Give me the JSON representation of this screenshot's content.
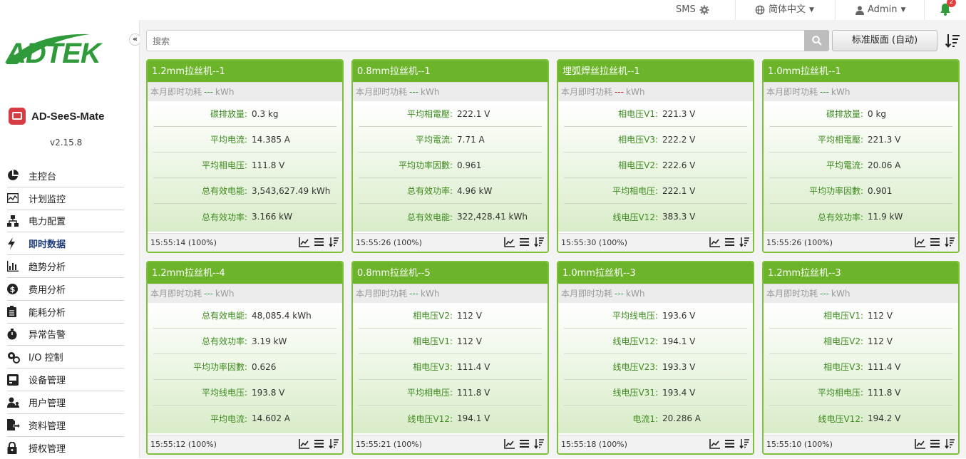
{
  "topbar": {
    "sms": "SMS",
    "language": "简体中文",
    "user": "Admin",
    "notifications": "2"
  },
  "sidebar": {
    "logo": "ADTEK",
    "app_name": "AD-SeeS-Mate",
    "version": "v2.15.8",
    "menu": [
      {
        "label": "主控台",
        "icon": "pie-chart-icon"
      },
      {
        "label": "计划监控",
        "icon": "monitor-icon"
      },
      {
        "label": "电力配置",
        "icon": "sitemap-icon"
      },
      {
        "label": "即时数据",
        "icon": "bolt-icon",
        "active": true
      },
      {
        "label": "趋势分析",
        "icon": "bar-chart-icon"
      },
      {
        "label": "费用分析",
        "icon": "dollar-icon"
      },
      {
        "label": "能耗分析",
        "icon": "clipboard-icon"
      },
      {
        "label": "异常告警",
        "icon": "alarm-icon"
      },
      {
        "label": "I/O 控制",
        "icon": "gears-icon"
      },
      {
        "label": "设备管理",
        "icon": "device-icon"
      },
      {
        "label": "用户管理",
        "icon": "users-icon"
      },
      {
        "label": "资料管理",
        "icon": "export-icon"
      },
      {
        "label": "授权管理",
        "icon": "lock-icon"
      }
    ]
  },
  "toolbar": {
    "search_placeholder": "搜索",
    "layout_button": "标准版面 (自动)"
  },
  "colors": {
    "brand_green": "#6cb52b",
    "label_green": "#3d8a1e",
    "active_menu": "#1c3a7a"
  },
  "cards": [
    {
      "title": "1.2mm拉丝机--1",
      "sub_label": "本月即时功耗",
      "sub_dash": "---",
      "sub_unit": "kWh",
      "rows": [
        {
          "label": "碳排放量:",
          "value": "0.3 kg"
        },
        {
          "label": "平均电流:",
          "value": "14.385 A"
        },
        {
          "label": "平均相电压:",
          "value": "111.8 V"
        },
        {
          "label": "总有效电能:",
          "value": "3,543,627.49 kWh"
        },
        {
          "label": "总有效功率:",
          "value": "3.166 kW"
        }
      ],
      "footer": "15:55:14 (100%)"
    },
    {
      "title": "0.8mm拉丝机--1",
      "sub_label": "本月即时功耗",
      "sub_dash": "---",
      "sub_unit": "kWh",
      "rows": [
        {
          "label": "平均相電壓:",
          "value": "222.1 V"
        },
        {
          "label": "平均電流:",
          "value": "7.71 A"
        },
        {
          "label": "平均功率因數:",
          "value": "0.961"
        },
        {
          "label": "总有效功率:",
          "value": "4.96 kW"
        },
        {
          "label": "总有效电能:",
          "value": "322,428.41 kWh"
        }
      ],
      "footer": "15:55:26 (100%)"
    },
    {
      "title": "埋弧焊丝拉丝机--1",
      "sub_label": "本月即时功耗",
      "sub_dash": "---",
      "sub_unit": "kWh",
      "dash_red": true,
      "rows": [
        {
          "label": "相电压V1:",
          "value": "221.3 V"
        },
        {
          "label": "相电压V3:",
          "value": "222.2 V"
        },
        {
          "label": "相电压V2:",
          "value": "222.6 V"
        },
        {
          "label": "平均相电压:",
          "value": "222.1 V"
        },
        {
          "label": "线电压V12:",
          "value": "383.3 V"
        }
      ],
      "footer": "15:55:30 (100%)"
    },
    {
      "title": "1.0mm拉丝机--1",
      "sub_label": "本月即时功耗",
      "sub_dash": "---",
      "sub_unit": "kWh",
      "rows": [
        {
          "label": "碳排放量:",
          "value": "0 kg"
        },
        {
          "label": "平均相電壓:",
          "value": "221.3 V"
        },
        {
          "label": "平均電流:",
          "value": "20.06 A"
        },
        {
          "label": "平均功率因數:",
          "value": "0.901"
        },
        {
          "label": "总有效功率:",
          "value": "11.9 kW"
        }
      ],
      "footer": "15:55:26 (100%)"
    },
    {
      "title": "1.2mm拉丝机--4",
      "sub_label": "本月即时功耗",
      "sub_dash": "---",
      "sub_unit": "kWh",
      "rows": [
        {
          "label": "总有效电能:",
          "value": "48,085.4 kWh"
        },
        {
          "label": "总有效功率:",
          "value": "3.19 kW"
        },
        {
          "label": "平均功率因數:",
          "value": "0.626"
        },
        {
          "label": "平均线电压:",
          "value": "193.8 V"
        },
        {
          "label": "平均电流:",
          "value": "14.602 A"
        }
      ],
      "footer": "15:55:12 (100%)"
    },
    {
      "title": "0.8mm拉丝机--5",
      "sub_label": "本月即时功耗",
      "sub_dash": "---",
      "sub_unit": "kWh",
      "rows": [
        {
          "label": "相电压V2:",
          "value": "112 V"
        },
        {
          "label": "相电压V1:",
          "value": "112 V"
        },
        {
          "label": "相电压V3:",
          "value": "111.4 V"
        },
        {
          "label": "平均相电压:",
          "value": "111.8 V"
        },
        {
          "label": "线电压V12:",
          "value": "194.1 V"
        }
      ],
      "footer": "15:55:21 (100%)"
    },
    {
      "title": "1.0mm拉丝机--3",
      "sub_label": "本月即时功耗",
      "sub_dash": "---",
      "sub_unit": "kWh",
      "rows": [
        {
          "label": "平均线电压:",
          "value": "193.6 V"
        },
        {
          "label": "线电压V12:",
          "value": "194.1 V"
        },
        {
          "label": "线电压V23:",
          "value": "193.3 V"
        },
        {
          "label": "线电压V31:",
          "value": "193.4 V"
        },
        {
          "label": "电流1:",
          "value": "20.286 A"
        }
      ],
      "footer": "15:55:18 (100%)"
    },
    {
      "title": "1.2mm拉丝机--3",
      "sub_label": "本月即时功耗",
      "sub_dash": "---",
      "sub_unit": "kWh",
      "rows": [
        {
          "label": "相电压V1:",
          "value": "112 V"
        },
        {
          "label": "相电压V2:",
          "value": "112 V"
        },
        {
          "label": "相电压V3:",
          "value": "111.4 V"
        },
        {
          "label": "平均相电压:",
          "value": "111.8 V"
        },
        {
          "label": "线电压V12:",
          "value": "194.2 V"
        }
      ],
      "footer": "15:55:10 (100%)"
    }
  ]
}
